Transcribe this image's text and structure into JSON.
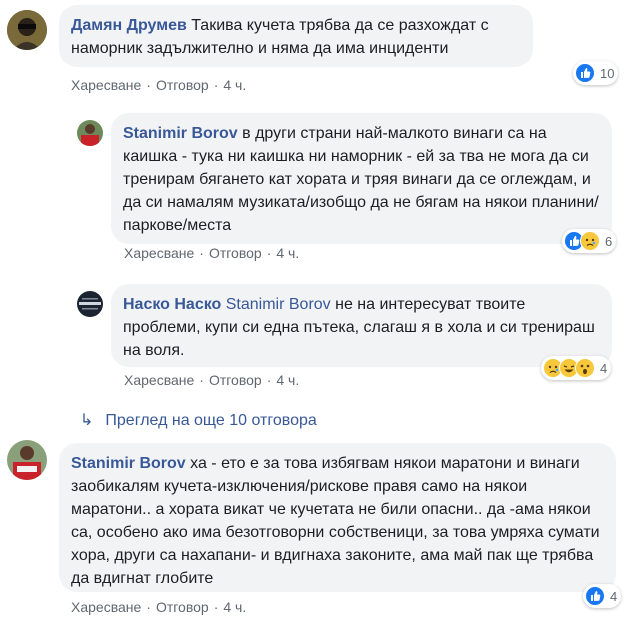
{
  "colors": {
    "author_link": "#385898",
    "bubble_bg": "#f2f3f5",
    "meta_text": "#606770",
    "like_blue": "#1877f2"
  },
  "comments": [
    {
      "author": "Дамян Друмев",
      "mention": "",
      "text": "Такива кучета трябва да се разхождат с наморник задължително и няма да има инциденти",
      "like_label": "Харесване",
      "reply_label": "Отговор",
      "time": "4 ч.",
      "reaction_icons": [
        "like-icon"
      ],
      "reaction_count": "10"
    },
    {
      "author": "Stanimir Borov",
      "mention": "",
      "text": "в други страни най-малкото винаги са на каишка - тука ни каишка ни наморник - ей за тва не мога да си тренирам бягането кат хората и тряя винаги да се оглеждам, и да си намалям музиката/изобщо да не бягам на някои планини/паркове/места",
      "like_label": "Харесване",
      "reply_label": "Отговор",
      "time": "4 ч.",
      "reaction_icons": [
        "like-icon",
        "sad-icon"
      ],
      "reaction_count": "6"
    },
    {
      "author": "Наско Наско",
      "mention": "Stanimir Borov",
      "text": "не на интересуват твоите проблеми, купи си една пътека, слагаш я в хола и си тренираш на воля.",
      "like_label": "Харесване",
      "reply_label": "Отговор",
      "time": "4 ч.",
      "reaction_icons": [
        "sad-icon",
        "laugh-icon",
        "wow-icon"
      ],
      "reaction_count": "4"
    },
    {
      "author": "Stanimir Borov",
      "mention": "",
      "text": "ха - ето е за това избягвам някои маратони и винаги заобикалям кучета-изключения/рискове правя само на някои маратони.. а хората викат че кучетата не били опасни.. да -ама някои са, особено ако има безотговорни собственици, за това умряха сумати хора, други са нахапани- и вдигнаха законите, ама май пак ще трябва да вдигнат глобите",
      "like_label": "Харесване",
      "reply_label": "Отговор",
      "time": "4 ч.",
      "reaction_icons": [
        "like-icon"
      ],
      "reaction_count": "4"
    }
  ],
  "more_replies": {
    "label": "Преглед на още 10 отговора"
  }
}
